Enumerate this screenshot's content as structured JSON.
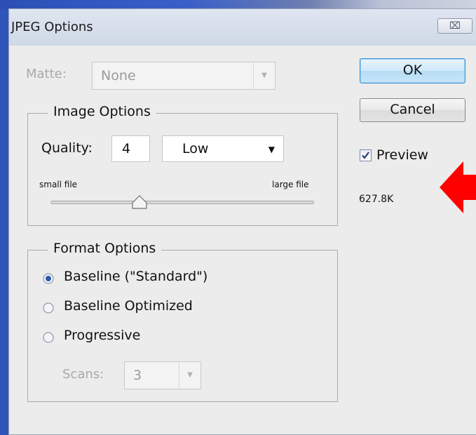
{
  "window": {
    "title": "JPEG Options",
    "close_symbol": "⌧"
  },
  "matte": {
    "label": "Matte:",
    "value": "None"
  },
  "buttons": {
    "ok": "OK",
    "cancel": "Cancel"
  },
  "image_options": {
    "legend": "Image Options",
    "quality_label": "Quality:",
    "quality_value": "4",
    "quality_preset": "Low",
    "small_file": "small file",
    "large_file": "large file",
    "slider_level": 0.36
  },
  "preview": {
    "label": "Preview",
    "checked": true,
    "file_size": "627.8K"
  },
  "format_options": {
    "legend": "Format Options",
    "options": [
      {
        "label": "Baseline (\"Standard\")",
        "selected": true
      },
      {
        "label": "Baseline Optimized",
        "selected": false
      },
      {
        "label": "Progressive",
        "selected": false
      }
    ],
    "scans_label": "Scans:",
    "scans_value": "3"
  },
  "colors": {
    "annotation_arrow": "#ff0000",
    "ok_border": "#3e8ed0"
  }
}
